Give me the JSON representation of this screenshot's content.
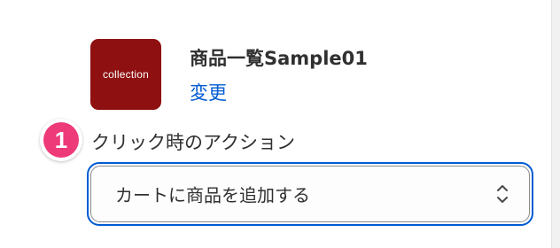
{
  "product": {
    "thumbnail_text": "collection",
    "title": "商品一覧Sample01",
    "change_link": "変更"
  },
  "step_badge": "1",
  "action_field": {
    "label": "クリック時のアクション",
    "selected_value": "カートに商品を追加する"
  },
  "colors": {
    "thumbnail": "#8e1010",
    "link": "#005bd3",
    "focus_ring": "#005bd3",
    "badge": "#ee3a79"
  },
  "icons": {
    "select": "chevron-up-down-icon"
  }
}
